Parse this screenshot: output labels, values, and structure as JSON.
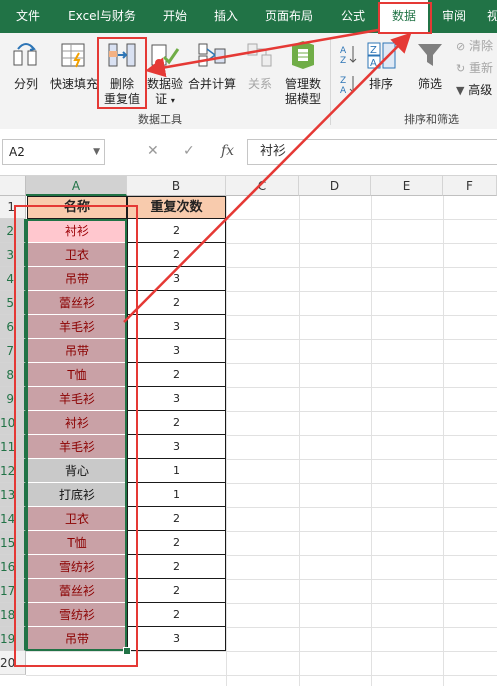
{
  "ribbon_tabs": [
    "文件",
    "Excel与财务",
    "开始",
    "插入",
    "页面布局",
    "公式",
    "数据",
    "审阅",
    "视"
  ],
  "active_tab": "数据",
  "ribbon": {
    "btn_split": "分列",
    "btn_flashfill": "快速填充",
    "btn_remove_dup_line1": "删除",
    "btn_remove_dup_line2": "重复值",
    "btn_validation_line1": "数据验",
    "btn_validation_line2": "证",
    "btn_consolidate": "合并计算",
    "btn_relations": "关系",
    "btn_datamodel_line1": "管理数",
    "btn_datamodel_line2": "据模型",
    "btn_sort": "排序",
    "btn_filter": "筛选",
    "btn_clear": "清除",
    "btn_reapply": "重新",
    "btn_advanced": "高级",
    "group_datatools": "数据工具",
    "group_sortfilter": "排序和筛选"
  },
  "formula_bar": {
    "name_box": "A2",
    "cancel_glyph": "✕",
    "enter_glyph": "✓",
    "fx_glyph": "fx",
    "formula": "衬衫"
  },
  "columns": [
    "A",
    "B",
    "C",
    "D",
    "E",
    "F"
  ],
  "rows": [
    "1",
    "2",
    "3",
    "4",
    "5",
    "6",
    "7",
    "8",
    "9",
    "10",
    "11",
    "12",
    "13",
    "14",
    "15",
    "16",
    "17",
    "18",
    "19",
    "20"
  ],
  "table": {
    "header_name": "名称",
    "header_count": "重复次数",
    "names": [
      "衬衫",
      "卫衣",
      "吊带",
      "蕾丝衫",
      "羊毛衫",
      "吊带",
      "T恤",
      "羊毛衫",
      "衬衫",
      "羊毛衫",
      "背心",
      "打底衫",
      "卫衣",
      "T恤",
      "雪纺衫",
      "蕾丝衫",
      "雪纺衫",
      "吊带"
    ],
    "counts": [
      "2",
      "2",
      "3",
      "2",
      "3",
      "3",
      "2",
      "3",
      "2",
      "3",
      "1",
      "1",
      "2",
      "2",
      "2",
      "2",
      "2",
      "3"
    ]
  },
  "colors": {
    "excel_green": "#217346",
    "annotation_red": "#e53935",
    "dup_fill": "#c9a1a6",
    "dup_text": "#8b0000",
    "header_fill": "#f8cbad"
  }
}
